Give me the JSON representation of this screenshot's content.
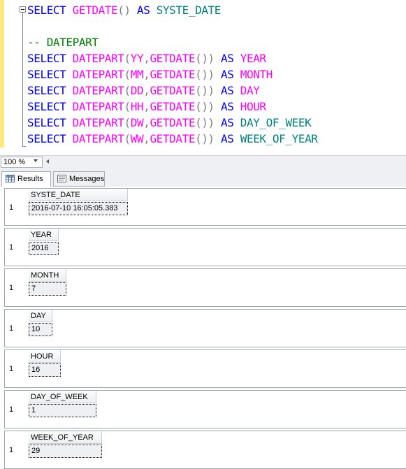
{
  "editor": {
    "lines": [
      [
        {
          "t": "SELECT",
          "c": "kw"
        },
        {
          "t": " "
        },
        {
          "t": "GETDATE",
          "c": "fn"
        },
        {
          "t": "()",
          "c": "gr"
        },
        {
          "t": " "
        },
        {
          "t": "AS",
          "c": "kw"
        },
        {
          "t": " "
        },
        {
          "t": "SYSTE_DATE",
          "c": "id"
        }
      ],
      [],
      [
        {
          "t": "-- DATEPART",
          "c": "cm"
        }
      ],
      [
        {
          "t": "SELECT",
          "c": "kw"
        },
        {
          "t": " "
        },
        {
          "t": "DATEPART",
          "c": "fn"
        },
        {
          "t": "(",
          "c": "gr"
        },
        {
          "t": "YY",
          "c": "fn"
        },
        {
          "t": ",",
          "c": "gr"
        },
        {
          "t": "GETDATE",
          "c": "fn"
        },
        {
          "t": "())",
          "c": "gr"
        },
        {
          "t": " "
        },
        {
          "t": "AS",
          "c": "kw"
        },
        {
          "t": " "
        },
        {
          "t": "YEAR",
          "c": "fn"
        }
      ],
      [
        {
          "t": "SELECT",
          "c": "kw"
        },
        {
          "t": " "
        },
        {
          "t": "DATEPART",
          "c": "fn"
        },
        {
          "t": "(",
          "c": "gr"
        },
        {
          "t": "MM",
          "c": "fn"
        },
        {
          "t": ",",
          "c": "gr"
        },
        {
          "t": "GETDATE",
          "c": "fn"
        },
        {
          "t": "())",
          "c": "gr"
        },
        {
          "t": " "
        },
        {
          "t": "AS",
          "c": "kw"
        },
        {
          "t": " "
        },
        {
          "t": "MONTH",
          "c": "fn"
        }
      ],
      [
        {
          "t": "SELECT",
          "c": "kw"
        },
        {
          "t": " "
        },
        {
          "t": "DATEPART",
          "c": "fn"
        },
        {
          "t": "(",
          "c": "gr"
        },
        {
          "t": "DD",
          "c": "fn"
        },
        {
          "t": ",",
          "c": "gr"
        },
        {
          "t": "GETDATE",
          "c": "fn"
        },
        {
          "t": "())",
          "c": "gr"
        },
        {
          "t": " "
        },
        {
          "t": "AS",
          "c": "kw"
        },
        {
          "t": " "
        },
        {
          "t": "DAY",
          "c": "fn"
        }
      ],
      [
        {
          "t": "SELECT",
          "c": "kw"
        },
        {
          "t": " "
        },
        {
          "t": "DATEPART",
          "c": "fn"
        },
        {
          "t": "(",
          "c": "gr"
        },
        {
          "t": "HH",
          "c": "fn"
        },
        {
          "t": ",",
          "c": "gr"
        },
        {
          "t": "GETDATE",
          "c": "fn"
        },
        {
          "t": "())",
          "c": "gr"
        },
        {
          "t": " "
        },
        {
          "t": "AS",
          "c": "kw"
        },
        {
          "t": " "
        },
        {
          "t": "HOUR",
          "c": "fn"
        }
      ],
      [
        {
          "t": "SELECT",
          "c": "kw"
        },
        {
          "t": " "
        },
        {
          "t": "DATEPART",
          "c": "fn"
        },
        {
          "t": "(",
          "c": "gr"
        },
        {
          "t": "DW",
          "c": "fn"
        },
        {
          "t": ",",
          "c": "gr"
        },
        {
          "t": "GETDATE",
          "c": "fn"
        },
        {
          "t": "())",
          "c": "gr"
        },
        {
          "t": " "
        },
        {
          "t": "AS",
          "c": "kw"
        },
        {
          "t": " "
        },
        {
          "t": "DAY_OF_WEEK",
          "c": "id"
        }
      ],
      [
        {
          "t": "SELECT",
          "c": "kw"
        },
        {
          "t": " "
        },
        {
          "t": "DATEPART",
          "c": "fn"
        },
        {
          "t": "(",
          "c": "gr"
        },
        {
          "t": "WW",
          "c": "fn"
        },
        {
          "t": ",",
          "c": "gr"
        },
        {
          "t": "GETDATE",
          "c": "fn"
        },
        {
          "t": "())",
          "c": "gr"
        },
        {
          "t": " "
        },
        {
          "t": "AS",
          "c": "kw"
        },
        {
          "t": " "
        },
        {
          "t": "WEEK_OF_YEAR",
          "c": "id"
        }
      ]
    ],
    "colors": {
      "keyword": "#0000ff",
      "function": "#ff00ff",
      "operator": "#808080",
      "identifier": "#008080",
      "comment": "#008000",
      "change_bar": "#ffe97f"
    }
  },
  "zoom": {
    "value": "100 %"
  },
  "tabs": {
    "results_label": "Results",
    "messages_label": "Messages",
    "results_icon": "grid-icon",
    "messages_icon": "messages-icon"
  },
  "results": {
    "grids": [
      {
        "column": "SYSTE_DATE",
        "row_number": "1",
        "value": "2016-07-10 16:05:05.383"
      },
      {
        "column": "YEAR",
        "row_number": "1",
        "value": "2016"
      },
      {
        "column": "MONTH",
        "row_number": "1",
        "value": "7"
      },
      {
        "column": "DAY",
        "row_number": "1",
        "value": "10"
      },
      {
        "column": "HOUR",
        "row_number": "1",
        "value": "16"
      },
      {
        "column": "DAY_OF_WEEK",
        "row_number": "1",
        "value": "1"
      },
      {
        "column": "WEEK_OF_YEAR",
        "row_number": "1",
        "value": "29"
      }
    ]
  }
}
